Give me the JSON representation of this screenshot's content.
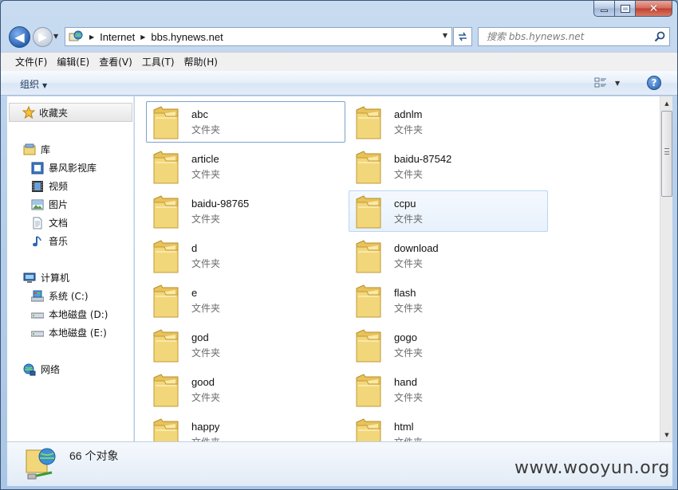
{
  "window": {
    "minimize": "—",
    "maximize": "□",
    "close": "✕"
  },
  "nav": {
    "back": "◀",
    "forward": "▶",
    "breadcrumb": [
      "Internet",
      "bbs.hynews.net"
    ],
    "search_placeholder": "搜索 bbs.hynews.net"
  },
  "menu": [
    "文件(F)",
    "编辑(E)",
    "查看(V)",
    "工具(T)",
    "帮助(H)"
  ],
  "command": {
    "organize": "组织",
    "help": "?"
  },
  "sidebar": {
    "favorites": "收藏夹",
    "library": "库",
    "library_items": [
      "暴风影视库",
      "视频",
      "图片",
      "文档",
      "音乐"
    ],
    "computer": "计算机",
    "drives": [
      "系统 (C:)",
      "本地磁盘 (D:)",
      "本地磁盘 (E:)"
    ],
    "network": "网络"
  },
  "folders": [
    {
      "name": "abc",
      "type": "文件夹"
    },
    {
      "name": "adnlm",
      "type": "文件夹"
    },
    {
      "name": "article",
      "type": "文件夹"
    },
    {
      "name": "baidu-87542",
      "type": "文件夹"
    },
    {
      "name": "baidu-98765",
      "type": "文件夹"
    },
    {
      "name": "ccpu",
      "type": "文件夹"
    },
    {
      "name": "d",
      "type": "文件夹"
    },
    {
      "name": "download",
      "type": "文件夹"
    },
    {
      "name": "e",
      "type": "文件夹"
    },
    {
      "name": "flash",
      "type": "文件夹"
    },
    {
      "name": "god",
      "type": "文件夹"
    },
    {
      "name": "gogo",
      "type": "文件夹"
    },
    {
      "name": "good",
      "type": "文件夹"
    },
    {
      "name": "hand",
      "type": "文件夹"
    },
    {
      "name": "happy",
      "type": "文件夹"
    },
    {
      "name": "html",
      "type": "文件夹"
    }
  ],
  "details": {
    "count": "66 个对象"
  },
  "watermark": "www.wooyun.org",
  "colors": {
    "accent": "#2a63b5",
    "folder": "#f2d77a",
    "selection_border": "#7da2ce",
    "hover_border": "#b8d6f6"
  }
}
